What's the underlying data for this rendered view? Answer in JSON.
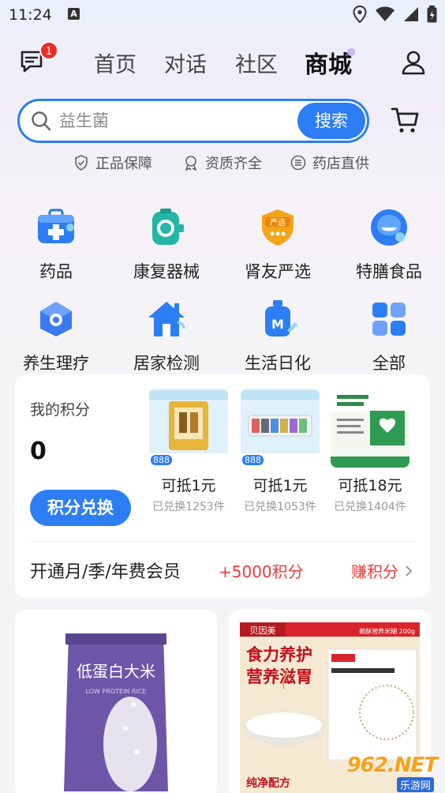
{
  "status_bar": {
    "time": "11:24",
    "notification_letter": "A"
  },
  "nav": {
    "message_badge": "1",
    "tabs": [
      {
        "label": "首页"
      },
      {
        "label": "对话"
      },
      {
        "label": "社区"
      },
      {
        "label": "商城"
      }
    ],
    "active_tab": "商城"
  },
  "search": {
    "placeholder": "益生菌",
    "button_label": "搜索"
  },
  "guarantees": [
    "正品保障",
    "资质齐全",
    "药店直供"
  ],
  "categories": [
    {
      "label": "药品",
      "icon": "medicine-kit-icon"
    },
    {
      "label": "康复器械",
      "icon": "rehab-device-icon"
    },
    {
      "label": "肾友严选",
      "icon": "selected-badge-icon"
    },
    {
      "label": "特膳食品",
      "icon": "special-food-icon"
    },
    {
      "label": "养生理疗",
      "icon": "therapy-icon"
    },
    {
      "label": "居家检测",
      "icon": "home-test-icon"
    },
    {
      "label": "生活日化",
      "icon": "daily-care-icon"
    },
    {
      "label": "全部",
      "icon": "grid-all-icon"
    }
  ],
  "points": {
    "title": "我的积分",
    "value": "0",
    "exchange_label": "积分兑换",
    "products": [
      {
        "price": "可抵1元",
        "sold": "已兑换1253件",
        "badge": "888"
      },
      {
        "price": "可抵1元",
        "sold": "已兑换1053件",
        "badge": "888"
      },
      {
        "price": "可抵18元",
        "sold": "已兑换1404件",
        "badge": ""
      }
    ],
    "membership_text": "开通月/季/年费会员",
    "bonus_text": "+5000积分",
    "earn_label": "赚积分"
  },
  "feed": [
    {
      "title": "低蛋白大米",
      "subtitle": "LOW PROTEIN RICE"
    },
    {
      "brand": "贝因美",
      "headline1": "食力养护",
      "headline2": "营养滋胃",
      "spec": "赖酥营养米糊 200g",
      "tagline": "纯净配方"
    }
  ],
  "watermark": {
    "logo": "962.NET",
    "sub": "乐游网"
  },
  "colors": {
    "accent": "#2d7ef4",
    "badge": "#ee2b2b",
    "bonus": "#ec3b3b"
  }
}
